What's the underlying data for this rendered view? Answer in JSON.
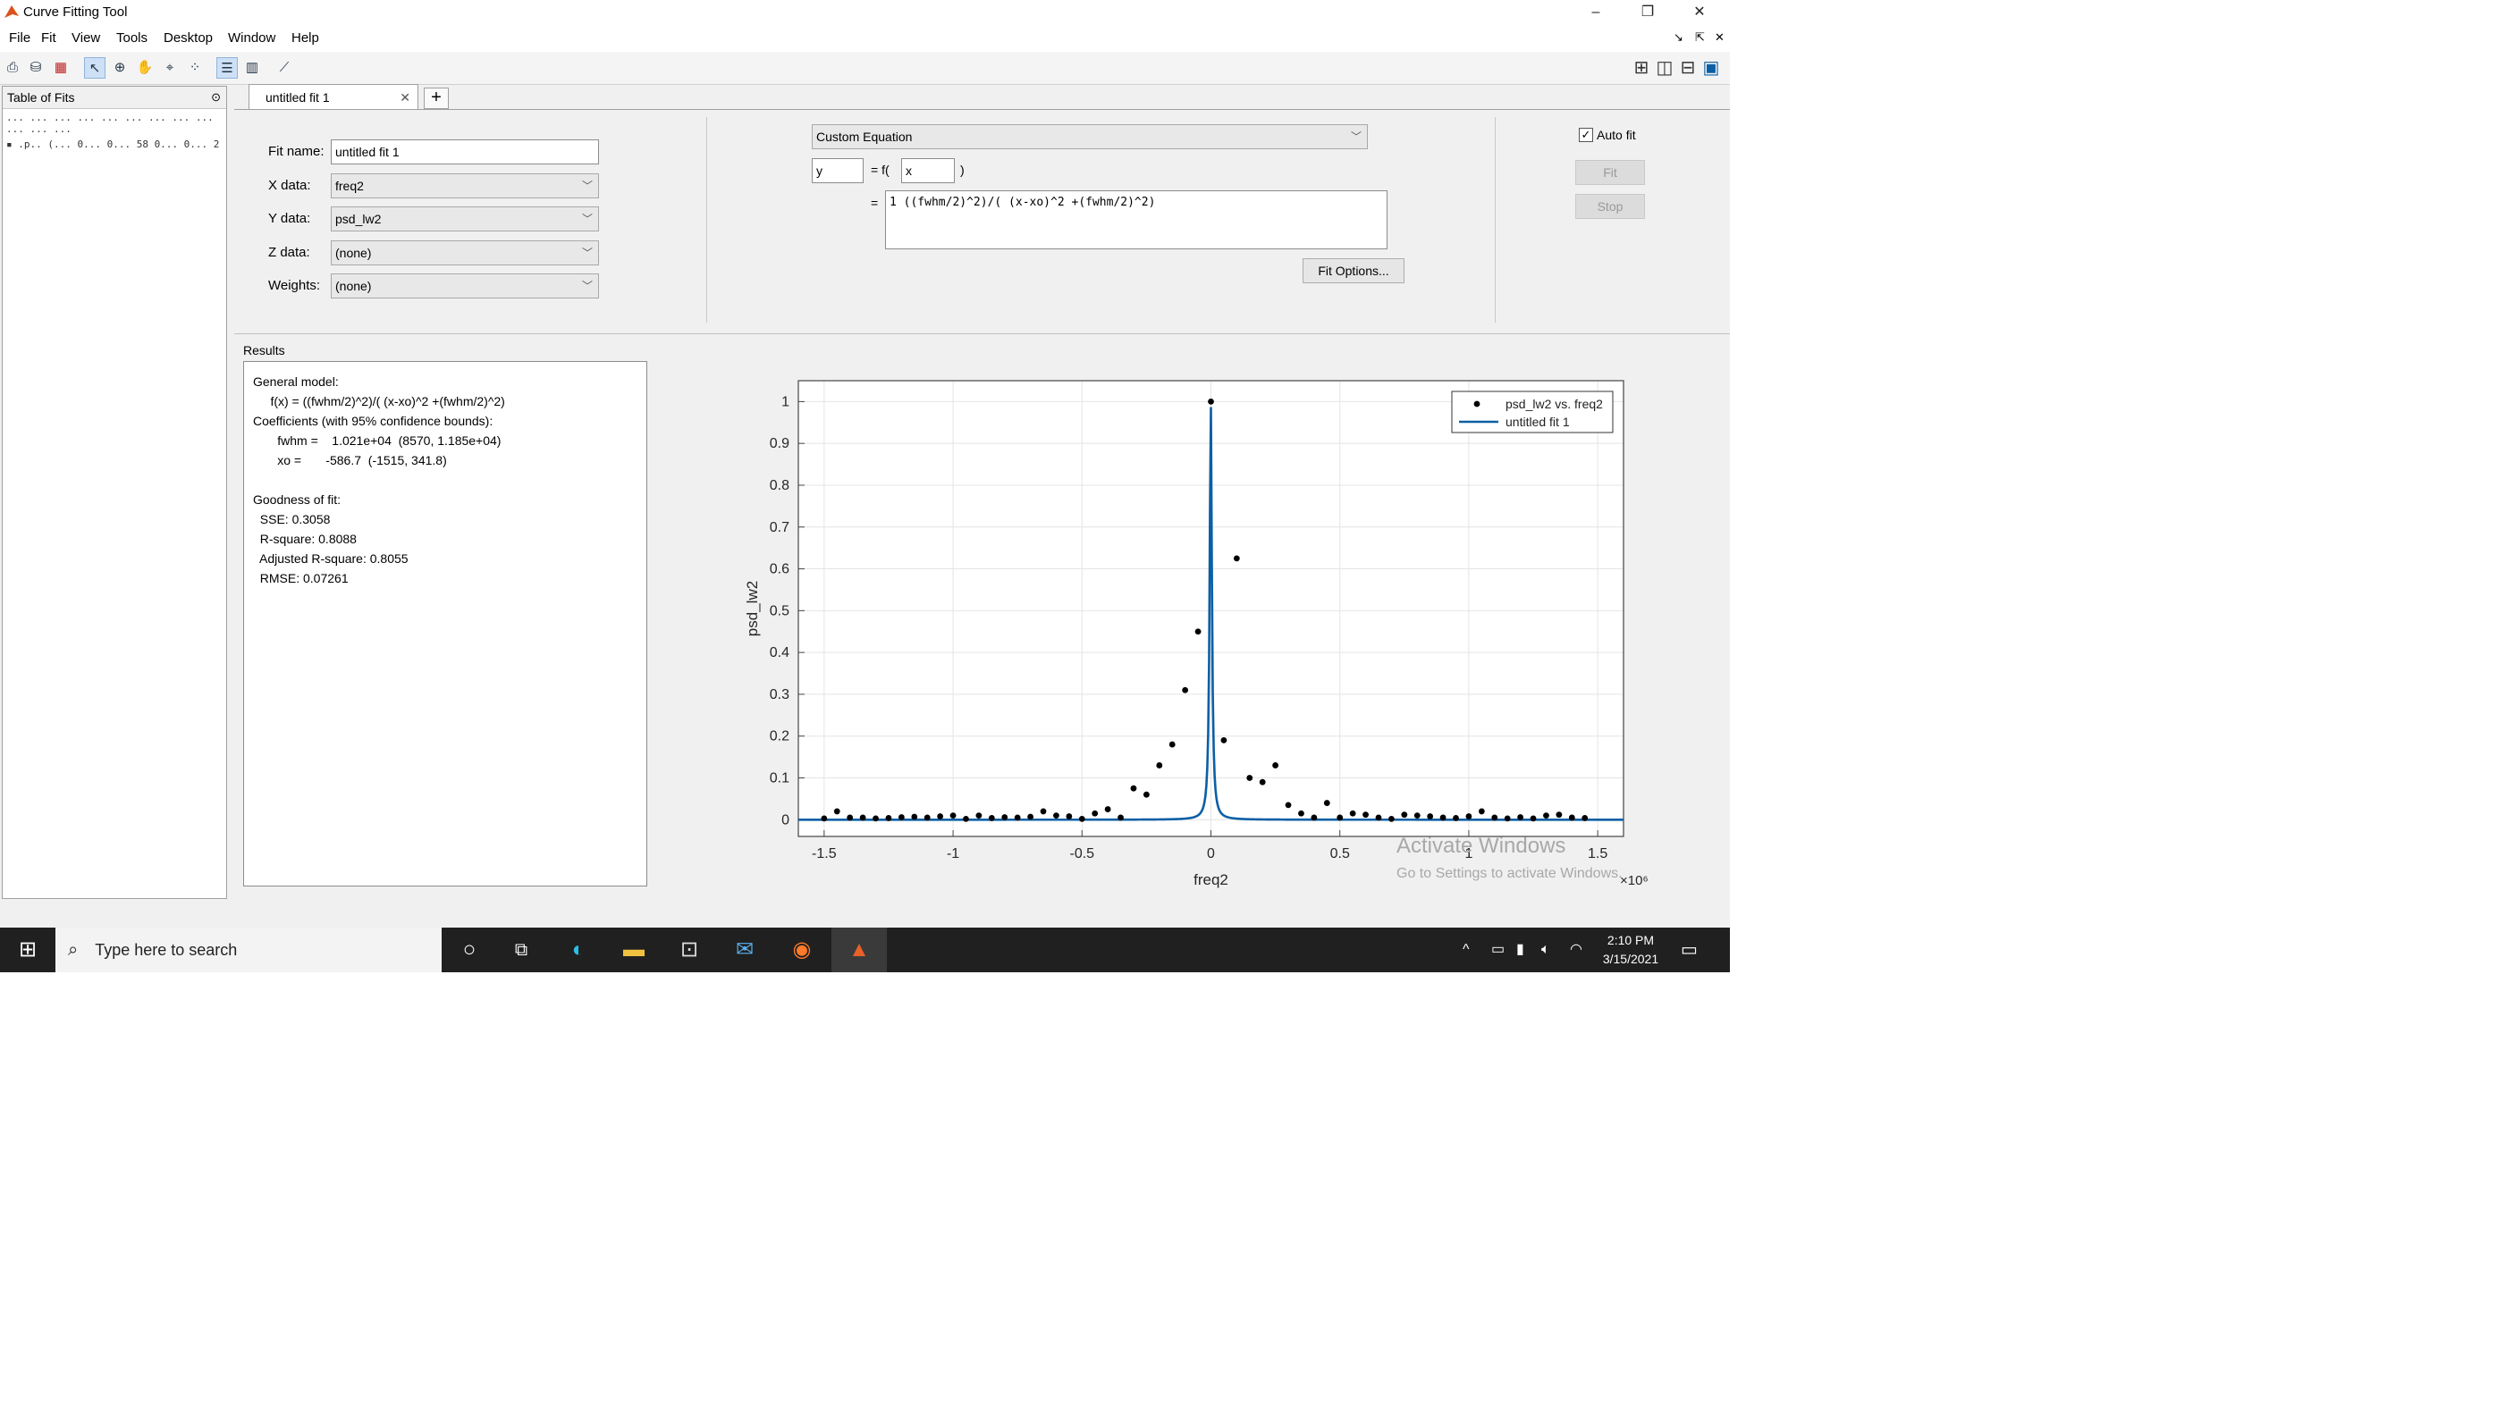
{
  "window": {
    "title": "Curve Fitting Tool",
    "controls": {
      "minimize": "–",
      "restore": "❐",
      "close": "✕",
      "undock": "↘",
      "dock": "⇱",
      "close_doc": "✕"
    }
  },
  "menu": [
    "File",
    "Fit",
    "View",
    "Tools",
    "Desktop",
    "Window",
    "Help"
  ],
  "table_of_fits": {
    "header": "Table of Fits",
    "header_row": "... ... ... ... ... ... ... ... ... ... ... ...",
    "row": "▪ .p.. (... 0... 0... 58 0... 0... 2"
  },
  "tabs": {
    "active": "untitled fit 1",
    "close": "✕",
    "add": "+"
  },
  "fit": {
    "name_label": "Fit name:",
    "name_value": "untitled fit 1",
    "x_label": "X data:",
    "x_value": "freq2",
    "y_label": "Y data:",
    "y_value": "psd_lw2",
    "z_label": "Z data:",
    "z_value": "(none)",
    "w_label": "Weights:",
    "w_value": "(none)",
    "type_value": "Custom Equation",
    "dep_var": "y",
    "eq_mid": "= f(",
    "indep_var": "x",
    "eq_close": ")",
    "eq_equals": "=",
    "equation": "1 ((fwhm/2)^2)/( (x-xo)^2 +(fwhm/2)^2)",
    "fit_options": "Fit Options...",
    "autofit_label": "Auto fit",
    "fit_button": "Fit",
    "stop_button": "Stop"
  },
  "results": {
    "title": "Results",
    "lines": [
      "General model:",
      "     f(x) = ((fwhm/2)^2)/( (x-xo)^2 +(fwhm/2)^2)",
      "Coefficients (with 95% confidence bounds):",
      "       fwhm =    1.021e+04  (8570, 1.185e+04)",
      "       xo =       -586.7  (-1515, 341.8)",
      "",
      "Goodness of fit:",
      "  SSE: 0.3058",
      "  R-square: 0.8088",
      "  Adjusted R-square: 0.8055",
      "  RMSE: 0.07261"
    ]
  },
  "chart_data": {
    "type": "scatter",
    "xlabel": "freq2",
    "ylabel": "psd_lw2",
    "x_exponent": "×10⁶",
    "xlim": [
      -1.6,
      1.6
    ],
    "ylim": [
      -0.04,
      1.05
    ],
    "xticks": [
      -1.5,
      -1,
      -0.5,
      0,
      0.5,
      1,
      1.5
    ],
    "xtick_labels": [
      "-1.5",
      "-1",
      "-0.5",
      "0",
      "0.5",
      "1",
      "1.5"
    ],
    "yticks": [
      0,
      0.1,
      0.2,
      0.3,
      0.4,
      0.5,
      0.6,
      0.7,
      0.8,
      0.9,
      1
    ],
    "ytick_labels": [
      "0",
      "0.1",
      "0.2",
      "0.3",
      "0.4",
      "0.5",
      "0.6",
      "0.7",
      "0.8",
      "0.9",
      "1"
    ],
    "grid": true,
    "legend_position": "top-right",
    "series": [
      {
        "name": "psd_lw2 vs. freq2",
        "kind": "points",
        "color": "#000000",
        "x": [
          -1.5,
          -1.45,
          -1.4,
          -1.35,
          -1.3,
          -1.25,
          -1.2,
          -1.15,
          -1.1,
          -1.05,
          -1.0,
          -0.95,
          -0.9,
          -0.85,
          -0.8,
          -0.75,
          -0.7,
          -0.65,
          -0.6,
          -0.55,
          -0.5,
          -0.45,
          -0.4,
          -0.35,
          -0.3,
          -0.25,
          -0.2,
          -0.15,
          -0.1,
          -0.05,
          0.0,
          0.05,
          0.1,
          0.15,
          0.2,
          0.25,
          0.3,
          0.35,
          0.4,
          0.45,
          0.5,
          0.55,
          0.6,
          0.65,
          0.7,
          0.75,
          0.8,
          0.85,
          0.9,
          0.95,
          1.0,
          1.05,
          1.1,
          1.15,
          1.2,
          1.25,
          1.3,
          1.35,
          1.4,
          1.45
        ],
        "y": [
          0.003,
          0.02,
          0.005,
          0.005,
          0.003,
          0.004,
          0.006,
          0.007,
          0.005,
          0.008,
          0.01,
          0.002,
          0.01,
          0.004,
          0.006,
          0.005,
          0.007,
          0.02,
          0.01,
          0.008,
          0.002,
          0.015,
          0.025,
          0.005,
          0.075,
          0.06,
          0.13,
          0.18,
          0.31,
          0.45,
          1.0,
          0.19,
          0.625,
          0.1,
          0.09,
          0.13,
          0.035,
          0.015,
          0.005,
          0.04,
          0.005,
          0.015,
          0.012,
          0.005,
          0.002,
          0.012,
          0.01,
          0.008,
          0.005,
          0.004,
          0.008,
          0.02,
          0.005,
          0.003,
          0.006,
          0.003,
          0.01,
          0.012,
          0.005,
          0.004
        ]
      },
      {
        "name": "untitled fit 1",
        "kind": "line",
        "color": "#0b5fa5",
        "model": "lorentzian",
        "fwhm": 10210,
        "xo": -586.7
      }
    ]
  },
  "watermark": {
    "line1": "Activate Windows",
    "line2": "Go to Settings to activate Windows."
  },
  "taskbar": {
    "search_placeholder": "Type here to search",
    "time": "2:10 PM",
    "date": "3/15/2021"
  },
  "colors": {
    "accent": "#0b5fa5",
    "taskbar": "#202020"
  }
}
